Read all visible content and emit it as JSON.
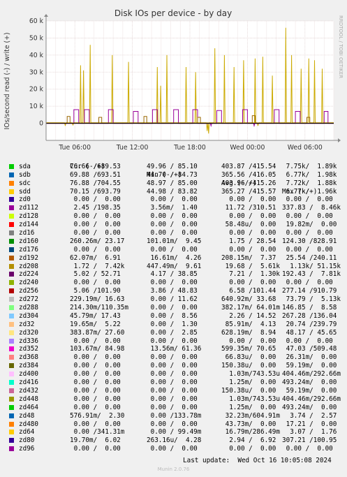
{
  "chart_data": {
    "type": "line",
    "title": "Disk IOs per device - by day",
    "ylabel": "IOs/second read (-) / write (+)",
    "watermark": "RRDTOOL / TOBI OETIKER",
    "ylim": [
      -10000,
      60000
    ],
    "yticks": [
      {
        "v": 60000,
        "label": "60 k"
      },
      {
        "v": 50000,
        "label": "50 k"
      },
      {
        "v": 40000,
        "label": "40 k"
      },
      {
        "v": 30000,
        "label": "30 k"
      },
      {
        "v": 20000,
        "label": "20 k"
      },
      {
        "v": 10000,
        "label": "10 k"
      },
      {
        "v": 0,
        "label": "0"
      }
    ],
    "xlim_hours": [
      27.0,
      57.0
    ],
    "xticks": [
      {
        "h": 30,
        "label": "Tue 06:00"
      },
      {
        "h": 36,
        "label": "Tue 12:00"
      },
      {
        "h": 42,
        "label": "Tue 18:00"
      },
      {
        "h": 48,
        "label": "Wed 00:00"
      },
      {
        "h": 54,
        "label": "Wed 06:00"
      }
    ],
    "grid": true,
    "colors": {
      "bg": "#f0f0f0",
      "plot": "#ffffff",
      "grid": "#e0d0d0",
      "minor": "#f0e6e6",
      "zero": "#000000",
      "axis": "#888888"
    },
    "series": [
      {
        "name": "sdd",
        "color": "#ccaa00",
        "baseline": 300,
        "peaks": [
          {
            "t": 30.6,
            "v": 34000
          },
          {
            "t": 30.9,
            "v": 31000
          },
          {
            "t": 31.6,
            "v": 46000
          },
          {
            "t": 33.9,
            "v": 40000
          },
          {
            "t": 35.6,
            "v": 36000
          },
          {
            "t": 38.6,
            "v": 33000
          },
          {
            "t": 38.95,
            "v": 22000
          },
          {
            "t": 39.6,
            "v": 40000
          },
          {
            "t": 41.6,
            "v": 33000
          },
          {
            "t": 42.6,
            "v": 30000
          },
          {
            "t": 44.6,
            "v": 44000
          },
          {
            "t": 45.6,
            "v": 40000
          },
          {
            "t": 46.6,
            "v": 33000
          },
          {
            "t": 47.6,
            "v": 37000
          },
          {
            "t": 48.8,
            "v": 38000
          },
          {
            "t": 49.6,
            "v": 39000
          },
          {
            "t": 50.6,
            "v": 28000
          },
          {
            "t": 52.0,
            "v": 56000
          },
          {
            "t": 52.6,
            "v": 40000
          },
          {
            "t": 53.6,
            "v": 32000
          },
          {
            "t": 54.4,
            "v": 38000
          },
          {
            "t": 55.0,
            "v": 37000
          },
          {
            "t": 55.8,
            "v": 32000
          }
        ],
        "dips": [
          {
            "t": 29.0,
            "v": -1500
          },
          {
            "t": 29.8,
            "v": -1200
          },
          {
            "t": 43.8,
            "v": -4500
          },
          {
            "t": 43.95,
            "v": -6000
          },
          {
            "t": 49.1,
            "v": -1500
          }
        ]
      },
      {
        "name": "zd112",
        "color": "#990099",
        "baseline": 0,
        "blocks": [
          {
            "s": 29.9,
            "e": 30.4,
            "v": 8000
          },
          {
            "s": 31.0,
            "e": 31.5,
            "v": 8000
          },
          {
            "s": 33.5,
            "e": 34.0,
            "v": 8000
          },
          {
            "s": 36.1,
            "e": 36.6,
            "v": 7000
          },
          {
            "s": 38.1,
            "e": 38.6,
            "v": 8000
          },
          {
            "s": 40.3,
            "e": 40.8,
            "v": 8000
          },
          {
            "s": 42.3,
            "e": 42.8,
            "v": 8000
          },
          {
            "s": 44.8,
            "e": 45.3,
            "v": 7500
          },
          {
            "s": 47.5,
            "e": 48.0,
            "v": 8000
          },
          {
            "s": 50.8,
            "e": 51.3,
            "v": 8000
          },
          {
            "s": 53.0,
            "e": 53.5,
            "v": 7000
          },
          {
            "s": 56.0,
            "e": 56.4,
            "v": 7000
          }
        ],
        "dips": [
          {
            "t": 44.2,
            "v": -1500
          },
          {
            "t": 48.7,
            "v": -1500
          }
        ]
      },
      {
        "name": "zd208",
        "color": "#996600",
        "baseline": 200,
        "blocks": [
          {
            "s": 29.2,
            "e": 29.5,
            "v": 4000
          },
          {
            "s": 32.5,
            "e": 32.8,
            "v": 3500
          },
          {
            "s": 37.2,
            "e": 37.5,
            "v": 4000
          },
          {
            "s": 42.8,
            "e": 43.1,
            "v": 3500
          },
          {
            "s": 48.5,
            "e": 48.8,
            "v": 4500
          },
          {
            "s": 54.2,
            "e": 54.5,
            "v": 3500
          }
        ]
      }
    ],
    "legend": {
      "headers": [
        "Cur (-/+)",
        "Min (-/+)",
        "Avg (-/+)",
        "Max (-/+)"
      ],
      "rows": [
        {
          "name": "sda",
          "color": "#00cc00",
          "cur": "76.66 /689.53",
          "min": "49.96 / 85.10",
          "avg": "403.87 /415.54",
          "max": " 7.75k/  1.89k"
        },
        {
          "name": "sdb",
          "color": "#0066b3",
          "cur": "69.88 /693.51",
          "min": "44.70 / 84.73",
          "avg": "365.56 /416.05",
          "max": " 6.77k/  1.98k"
        },
        {
          "name": "sdc",
          "color": "#ff8000",
          "cur": "76.88 /704.55",
          "min": "48.97 / 85.00",
          "avg": "403.96 /415.26",
          "max": " 7.72k/  1.88k"
        },
        {
          "name": "sdd",
          "color": "#ffcc00",
          "cur": "70.15 /693.79",
          "min": "44.98 / 83.82",
          "avg": "365.27 /415.57",
          "max": " 6.77k/  1.96k"
        },
        {
          "name": "zd0",
          "color": "#330099",
          "cur": " 0.00 /  0.00",
          "min": " 0.00 /  0.00",
          "avg": "  0.00 /  0.00",
          "max": " 0.00 /  0.00"
        },
        {
          "name": "zd112",
          "color": "#990099",
          "cur": " 2.45 /198.35",
          "min": " 3.56m/  1.40",
          "avg": " 11.72 /310.51",
          "max": "337.83 /  8.46k"
        },
        {
          "name": "zd128",
          "color": "#ccff00",
          "cur": " 0.00 /  0.00",
          "min": " 0.00 /  0.00",
          "avg": "  0.00 /  0.00",
          "max": " 0.00 /  0.00"
        },
        {
          "name": "zd144",
          "color": "#ff0000",
          "cur": " 0.00 /  0.00",
          "min": " 0.00 /  0.00",
          "avg": " 58.48u/  0.00",
          "max": " 19.82m/  0.00"
        },
        {
          "name": "zd16",
          "color": "#808080",
          "cur": " 0.00 /  0.00",
          "min": " 0.00 /  0.00",
          "avg": "  0.00 /  0.00",
          "max": " 0.00 /  0.00"
        },
        {
          "name": "zd160",
          "color": "#008f00",
          "cur": "260.26m/ 23.17",
          "min": "101.01m/  9.45",
          "avg": "  1.75 / 28.54",
          "max": "124.30 /828.91"
        },
        {
          "name": "zd176",
          "color": "#00487d",
          "cur": " 0.00 /  0.00",
          "min": " 0.00 /  0.00",
          "avg": "  0.00 /  0.00",
          "max": " 0.00 /  0.00"
        },
        {
          "name": "zd192",
          "color": "#b35a00",
          "cur": "62.07m/  6.91",
          "min": " 16.61m/  4.26",
          "avg": "208.15m/  7.37",
          "max": " 25.54 /240.11"
        },
        {
          "name": "zd208",
          "color": "#b38f00",
          "cur": " 1.72 /  7.42k",
          "min": "447.49m/  9.61",
          "avg": " 19.68 /  5.61k",
          "max": "  1.13k/ 51.15k"
        },
        {
          "name": "zd224",
          "color": "#6b006b",
          "cur": " 5.02 / 52.71",
          "min": " 4.17 / 38.85",
          "avg": "  7.21 /  1.30k",
          "max": "192.43 /  7.81k"
        },
        {
          "name": "zd240",
          "color": "#8fb300",
          "cur": " 0.00 /  0.00",
          "min": " 0.00 /  0.00",
          "avg": "  0.00 /  0.00",
          "max": " 0.00 /  0.00"
        },
        {
          "name": "zd256",
          "color": "#b30000",
          "cur": " 5.06 /101.90",
          "min": " 3.86 / 48.83",
          "avg": "  6.58 /101.44",
          "max": "277.14 /910.79"
        },
        {
          "name": "zd272",
          "color": "#bebebe",
          "cur": "229.19m/ 16.63",
          "min": " 0.00 / 11.62",
          "avg": "640.92m/ 33.68",
          "max": " 73.79 /  5.13k"
        },
        {
          "name": "zd288",
          "color": "#80ff80",
          "cur": "214.30m/110.35m",
          "min": " 0.00 /  0.00",
          "avg": "382.17m/ 64.01m",
          "max": "146.85 /  8.58"
        },
        {
          "name": "zd304",
          "color": "#80c9ff",
          "cur": "45.79m/ 17.43",
          "min": " 0.00 /  8.56",
          "avg": "  2.26 / 14.52",
          "max": "267.28 /136.04"
        },
        {
          "name": "zd32",
          "color": "#ffc080",
          "cur": "19.65m/  5.22",
          "min": " 0.00 /  1.30",
          "avg": " 85.91m/  4.13",
          "max": " 20.74 /239.79"
        },
        {
          "name": "zd320",
          "color": "#ffe680",
          "cur": "383.87m/ 27.60",
          "min": " 0.00 /  2.85",
          "avg": "628.19m/  8.94",
          "max": " 48.17 / 45.65"
        },
        {
          "name": "zd336",
          "color": "#aa80ff",
          "cur": " 0.00 /  0.00",
          "min": " 0.00 /  0.00",
          "avg": "  0.00 /  0.00",
          "max": " 0.00 /  0.00"
        },
        {
          "name": "zd352",
          "color": "#ee00cc",
          "cur": "103.67m/ 84.98",
          "min": " 13.56m/ 61.36",
          "avg": "599.35m/ 70.65",
          "max": " 47.03 /509.48"
        },
        {
          "name": "zd368",
          "color": "#ff8080",
          "cur": " 0.00 /  0.00",
          "min": " 0.00 /  0.00",
          "avg": " 66.83u/  0.00",
          "max": " 26.31m/  0.00"
        },
        {
          "name": "zd384",
          "color": "#666600",
          "cur": " 0.00 /  0.00",
          "min": " 0.00 /  0.00",
          "avg": "150.38u/  0.00",
          "max": " 59.19m/  0.00"
        },
        {
          "name": "zd400",
          "color": "#ffbfff",
          "cur": " 0.00 /  0.00",
          "min": " 0.00 /  0.00",
          "avg": "  1.03m/743.53u",
          "max": "404.46m/292.66m"
        },
        {
          "name": "zd416",
          "color": "#00ffcc",
          "cur": " 0.00 /  0.00",
          "min": " 0.00 /  0.00",
          "avg": "  1.25m/  0.00",
          "max": "493.24m/  0.00"
        },
        {
          "name": "zd432",
          "color": "#cc6699",
          "cur": " 0.00 /  0.00",
          "min": " 0.00 /  0.00",
          "avg": "150.38u/  0.00",
          "max": " 59.19m/  0.00"
        },
        {
          "name": "zd448",
          "color": "#999900",
          "cur": " 0.00 /  0.00",
          "min": " 0.00 /  0.00",
          "avg": "  1.03m/743.53u",
          "max": "404.46m/292.66m"
        },
        {
          "name": "zd464",
          "color": "#00cc00",
          "cur": " 0.00 /  0.00",
          "min": " 0.00 /  0.00",
          "avg": "  1.25m/  0.00",
          "max": "493.24m/  0.00"
        },
        {
          "name": "zd48",
          "color": "#0066b3",
          "cur": "576.91m/  2.30",
          "min": " 0.00 /133.78m",
          "avg": " 32.23m/604.91m",
          "max": "  3.74 /  2.57"
        },
        {
          "name": "zd480",
          "color": "#ff8000",
          "cur": " 0.00 /  0.00",
          "min": " 0.00 /  0.00",
          "avg": " 43.73m/  0.00",
          "max": " 17.21 /  0.00"
        },
        {
          "name": "zd64",
          "color": "#ffcc00",
          "cur": " 0.00 /341.31m",
          "min": " 0.00 / 99.49m",
          "avg": " 16.79m/286.49m",
          "max": "  3.07 /  1.76"
        },
        {
          "name": "zd80",
          "color": "#330099",
          "cur": "19.70m/  6.02",
          "min": "263.16u/  4.28",
          "avg": "  2.94 /  6.92",
          "max": "307.21 /100.95"
        },
        {
          "name": "zd96",
          "color": "#990099",
          "cur": " 0.00 /  0.00",
          "min": " 0.00 /  0.00",
          "avg": "  0.00 /  0.00",
          "max": " 0.00 /  0.00"
        }
      ]
    },
    "last_update": "Last update:  Wed Oct 16 10:05:08 2024",
    "version": "Munin 2.0.76"
  }
}
